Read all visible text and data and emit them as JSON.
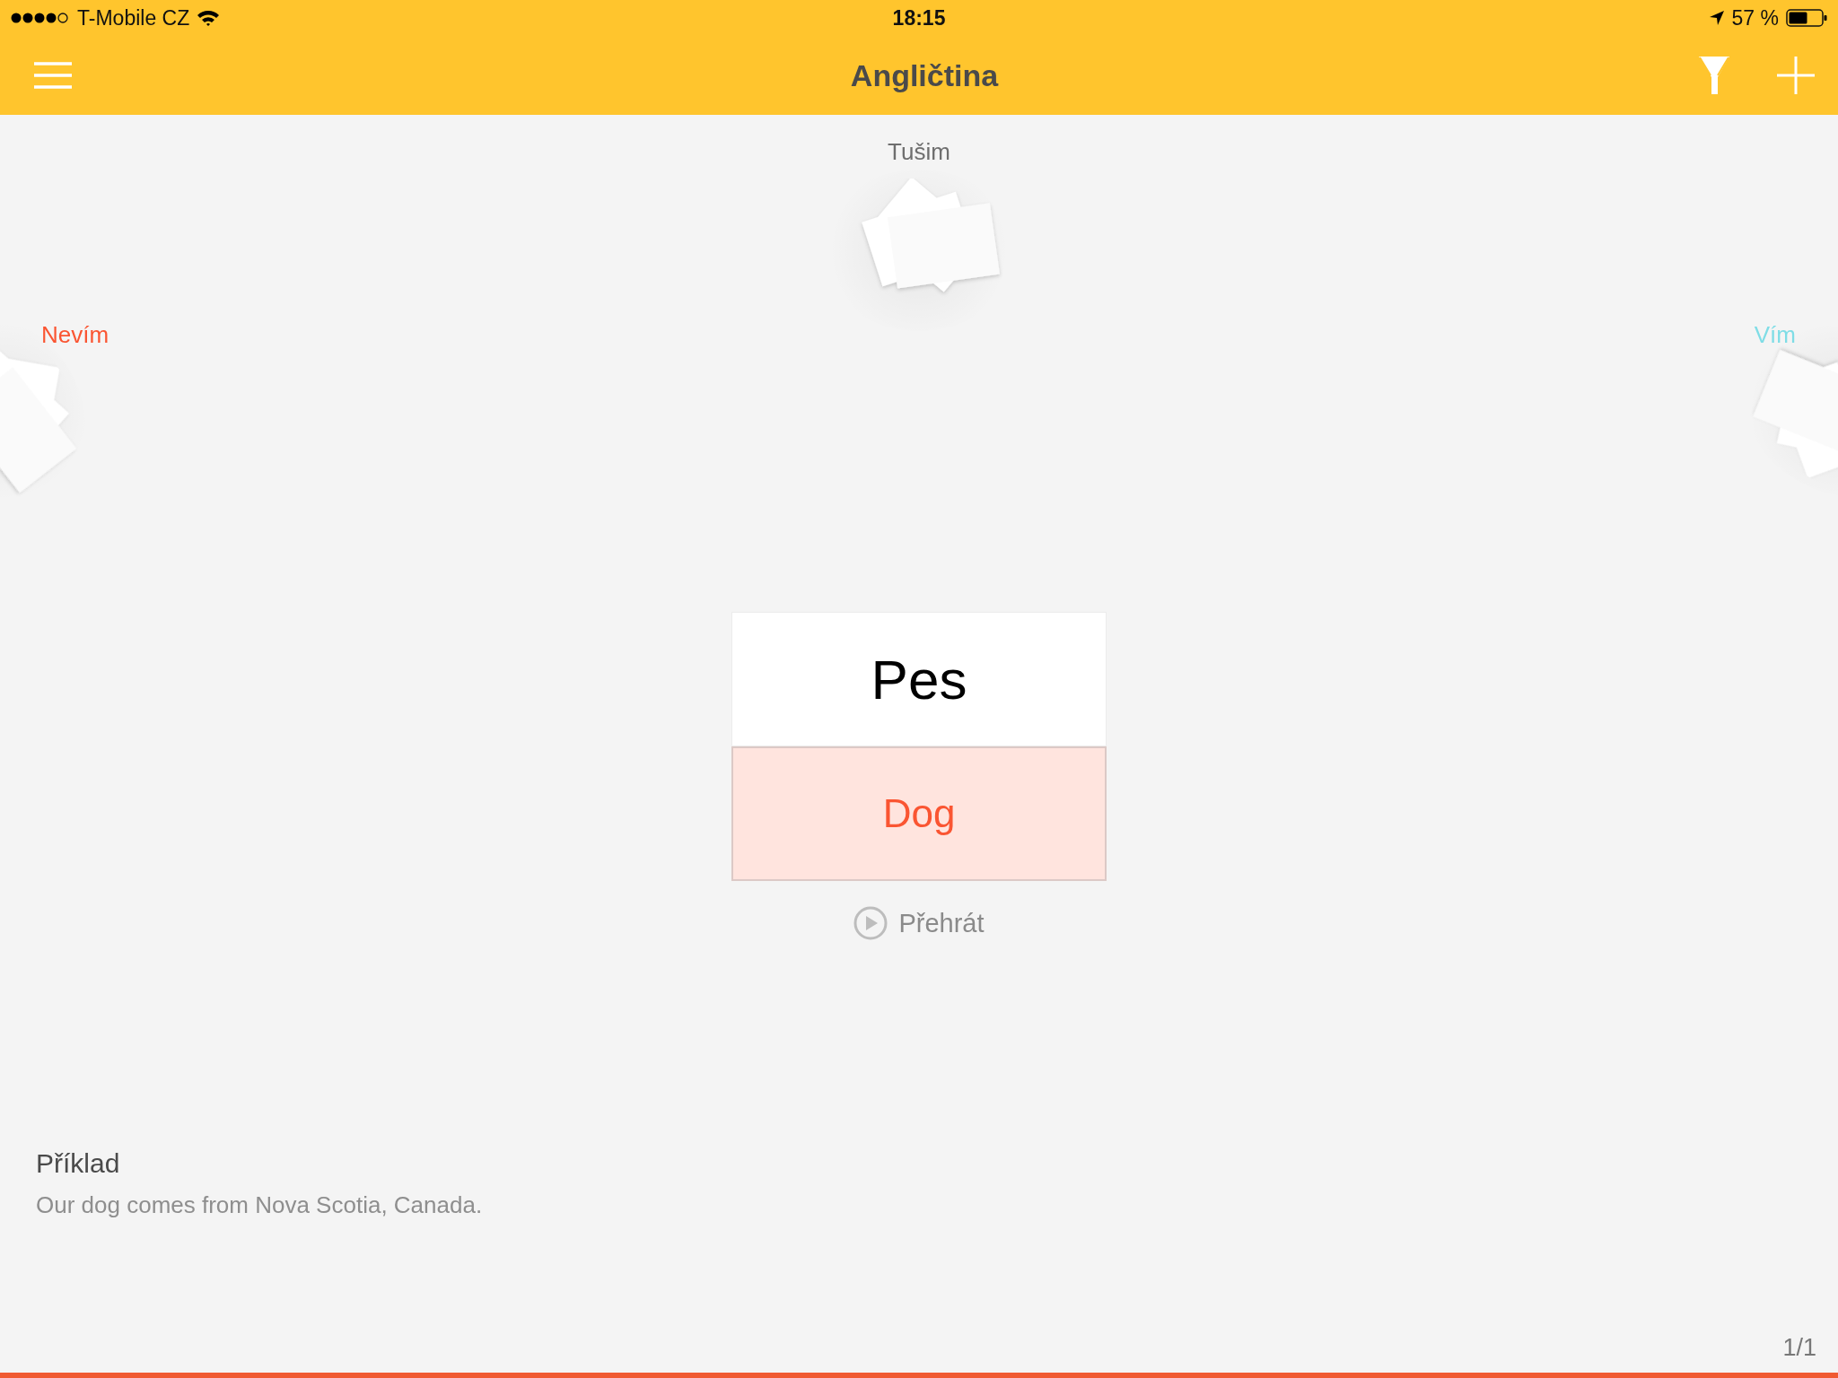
{
  "status_bar": {
    "carrier": "T-Mobile CZ",
    "time": "18:15",
    "battery": "57 %"
  },
  "nav_bar": {
    "title": "Angličtina"
  },
  "piles": [
    {
      "kind": "top",
      "label": "Tušim",
      "color": "#6e6e6e"
    },
    {
      "kind": "left",
      "label": "Nevím",
      "color": "#fa5532"
    },
    {
      "kind": "right",
      "label": "Vím",
      "color": "#7fdde6"
    }
  ],
  "card": {
    "front": "Pes",
    "back": "Dog"
  },
  "play_button": {
    "label": "Přehrát"
  },
  "example": {
    "heading": "Příklad",
    "text": "Our dog comes from Nova Scotia, Canada."
  },
  "counter": "1/1",
  "progress": {
    "level": 1
  }
}
